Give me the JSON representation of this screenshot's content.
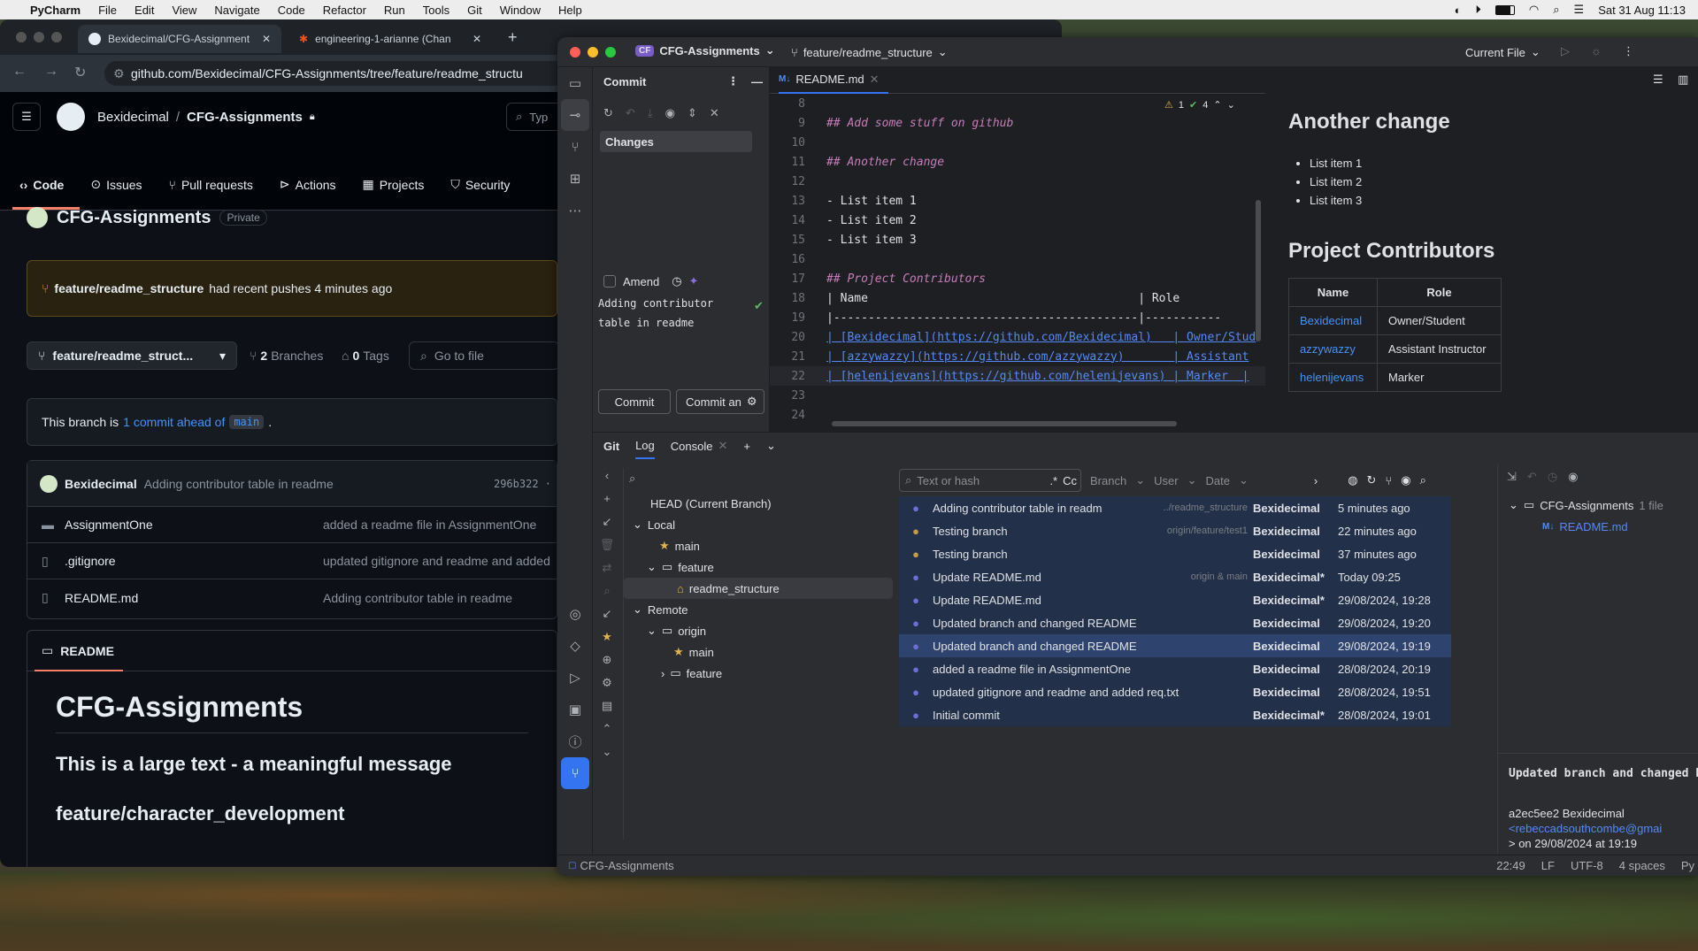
{
  "menubar": {
    "app": "PyCharm",
    "items": [
      "File",
      "Edit",
      "View",
      "Navigate",
      "Code",
      "Refactor",
      "Run",
      "Tools",
      "Git",
      "Window",
      "Help"
    ],
    "clock": "Sat 31 Aug  11:13"
  },
  "browser": {
    "tabs": [
      {
        "label": "Bexidecimal/CFG-Assignment"
      },
      {
        "label": "engineering-1-arianne (Chan"
      }
    ],
    "url": "github.com/Bexidecimal/CFG-Assignments/tree/feature/readme_structu",
    "owner": "Bexidecimal",
    "repo": "CFG-Assignments",
    "search_placeholder": "Typ",
    "nav": [
      "Code",
      "Issues",
      "Pull requests",
      "Actions",
      "Projects",
      "Security"
    ],
    "repo_title": "CFG-Assignments",
    "private_badge": "Private",
    "push_banner": {
      "branch": "feature/readme_structure",
      "text": "had recent pushes 4 minutes ago"
    },
    "branch_select": "feature/readme_struct...",
    "branches_count": "2",
    "branches_label": "Branches",
    "tags_count": "0",
    "tags_label": "Tags",
    "goto_file": "Go to file",
    "ahead": {
      "prefix": "This branch is",
      "link": "1 commit ahead of",
      "base": "main",
      "suffix": "."
    },
    "last_commit": {
      "author": "Bexidecimal",
      "message": "Adding contributor table in readme",
      "hash": "296b322 ·"
    },
    "files": [
      {
        "type": "folder",
        "name": "AssignmentOne",
        "message": "added a readme file in AssignmentOne"
      },
      {
        "type": "file",
        "name": ".gitignore",
        "message": "updated gitignore and readme and added"
      },
      {
        "type": "file",
        "name": "README.md",
        "message": "Adding contributor table in readme"
      }
    ],
    "readme_tab": "README",
    "readme": {
      "h1": "CFG-Assignments",
      "h2a": "This is a large text - a meaningful message",
      "h2b": "feature/character_development"
    }
  },
  "ide": {
    "project": "CFG-Assignments",
    "project_badge": "CF",
    "branch": "feature/readme_structure",
    "run_config": "Current File",
    "commit_panel": {
      "title": "Commit",
      "changes": "Changes",
      "amend": "Amend",
      "message": "Adding contributor table in readme",
      "commit_btn": "Commit",
      "commit_push_btn": "Commit an"
    },
    "editor_tab": "README.md",
    "inspections": {
      "warnings": "1",
      "ok": "4"
    },
    "code": [
      {
        "n": "8",
        "t": ""
      },
      {
        "n": "9",
        "t": "## Add some stuff on github",
        "k": "h"
      },
      {
        "n": "10",
        "t": ""
      },
      {
        "n": "11",
        "t": "## Another change",
        "k": "h"
      },
      {
        "n": "12",
        "t": ""
      },
      {
        "n": "13",
        "t": "- List item 1"
      },
      {
        "n": "14",
        "t": "- List item 2"
      },
      {
        "n": "15",
        "t": "- List item 3"
      },
      {
        "n": "16",
        "t": ""
      },
      {
        "n": "17",
        "t": "## Project Contributors",
        "k": "h"
      },
      {
        "n": "18",
        "t": "| Name                                       | Role"
      },
      {
        "n": "19",
        "t": "|--------------------------------------------|-----------"
      },
      {
        "n": "20",
        "t": "| [Bexidecimal](https://github.com/Bexidecimal)   | Owner/Stud",
        "k": "l"
      },
      {
        "n": "21",
        "t": "| [azzywazzy](https://github.com/azzywazzy)       | Assistant",
        "k": "l"
      },
      {
        "n": "22",
        "t": "| [helenijevans](https://github.com/helenijevans) | Marker  |",
        "k": "l"
      },
      {
        "n": "23",
        "t": ""
      },
      {
        "n": "24",
        "t": ""
      }
    ],
    "preview": {
      "h2": "Another change",
      "list": [
        "List item 1",
        "List item 2",
        "List item 3"
      ],
      "h2b": "Project Contributors",
      "table": {
        "headers": [
          "Name",
          "Role"
        ],
        "rows": [
          [
            "Bexidecimal",
            "Owner/Student"
          ],
          [
            "azzywazzy",
            "Assistant Instructor"
          ],
          [
            "helenijevans",
            "Marker"
          ]
        ]
      }
    },
    "bottom_tabs": [
      "Git",
      "Log",
      "Console"
    ],
    "branches": {
      "head": "HEAD (Current Branch)",
      "local": "Local",
      "main": "main",
      "feature": "feature",
      "readme_structure": "readme_structure",
      "remote": "Remote",
      "origin": "origin",
      "origin_main": "main",
      "origin_feature": "feature"
    },
    "log_filters": {
      "search": "Text or hash",
      "regex": ".*",
      "cc": "Cc",
      "branch": "Branch",
      "user": "User",
      "date": "Date"
    },
    "log": [
      {
        "msg": "Adding contributor table in readm",
        "ref": "../readme_structure",
        "author": "Bexidecimal",
        "date": "5 minutes ago"
      },
      {
        "msg": "Testing branch",
        "ref": "origin/feature/test1",
        "author": "Bexidecimal",
        "date": "22 minutes ago"
      },
      {
        "msg": "Testing branch",
        "ref": "",
        "author": "Bexidecimal",
        "date": "37 minutes ago"
      },
      {
        "msg": "Update README.md",
        "ref": "origin & main",
        "author": "Bexidecimal*",
        "date": "Today 09:25"
      },
      {
        "msg": "Update README.md",
        "ref": "",
        "author": "Bexidecimal*",
        "date": "29/08/2024, 19:28"
      },
      {
        "msg": "Updated branch and changed README",
        "ref": "",
        "author": "Bexidecimal",
        "date": "29/08/2024, 19:20"
      },
      {
        "msg": "Updated branch and changed README",
        "ref": "",
        "author": "Bexidecimal",
        "date": "29/08/2024, 19:19"
      },
      {
        "msg": "added a readme file in AssignmentOne",
        "ref": "",
        "author": "Bexidecimal",
        "date": "28/08/2024, 20:19"
      },
      {
        "msg": "updated gitignore and readme and added req.txt",
        "ref": "",
        "author": "Bexidecimal",
        "date": "28/08/2024, 19:51"
      },
      {
        "msg": "Initial commit",
        "ref": "",
        "author": "Bexidecimal*",
        "date": "28/08/2024, 19:01"
      }
    ],
    "details": {
      "root": "CFG-Assignments",
      "count": "1 file",
      "file": "README.md",
      "title": "Updated branch and changed README",
      "hash": "a2ec5ee2 Bexidecimal",
      "email": "<rebeccadsouthcombe@gmai",
      "email2": "> on 29/08/2024 at 19:19"
    },
    "status": {
      "project": "CFG-Assignments",
      "pos": "22:49",
      "eol": "LF",
      "enc": "UTF-8",
      "indent": "4 spaces",
      "lang": "Py"
    }
  }
}
